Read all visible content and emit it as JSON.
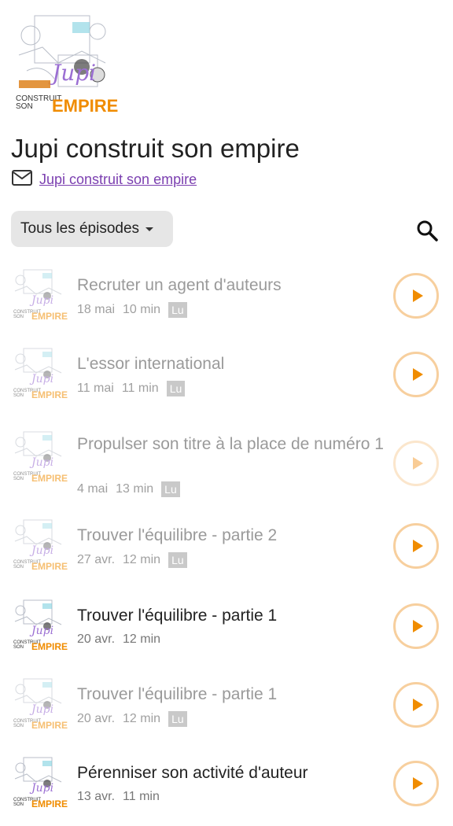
{
  "podcast": {
    "title": "Jupi construit son empire",
    "author_link": "Jupi construit son empire",
    "cover_title": "Jupi",
    "cover_sub1": "CONSTRUIT",
    "cover_sub2": "SON",
    "cover_word": "EMPIRE"
  },
  "filter": {
    "label": "Tous les épisodes"
  },
  "colors": {
    "accent": "#f08c00",
    "link": "#7b3fb0",
    "play_ring": "#f7cf9e"
  },
  "icons": {
    "mail": "mail-icon",
    "search": "search-icon",
    "play": "play-icon",
    "dropdown": "chevron-down-icon"
  },
  "episodes": [
    {
      "title": "Recruter un agent d'auteurs",
      "date": "18 mai",
      "duration": "10 min",
      "badge": "Lu",
      "played": true
    },
    {
      "title": "L'essor international",
      "date": "11 mai",
      "duration": "11 min",
      "badge": "Lu",
      "played": true
    },
    {
      "title": "Propulser son titre à la place de numéro 1",
      "date": "4 mai",
      "duration": "13 min",
      "badge": "Lu",
      "played": true
    },
    {
      "title": "Trouver l'équilibre - partie 2",
      "date": "27 avr.",
      "duration": "12 min",
      "badge": "Lu",
      "played": true
    },
    {
      "title": "Trouver l'équilibre - partie 1",
      "date": "20 avr.",
      "duration": "12 min",
      "badge": null,
      "played": false
    },
    {
      "title": "Trouver l'équilibre - partie 1",
      "date": "20 avr.",
      "duration": "12 min",
      "badge": "Lu",
      "played": true
    },
    {
      "title": "Pérenniser son activité d'auteur",
      "date": "13 avr.",
      "duration": "11 min",
      "badge": null,
      "played": false
    }
  ]
}
